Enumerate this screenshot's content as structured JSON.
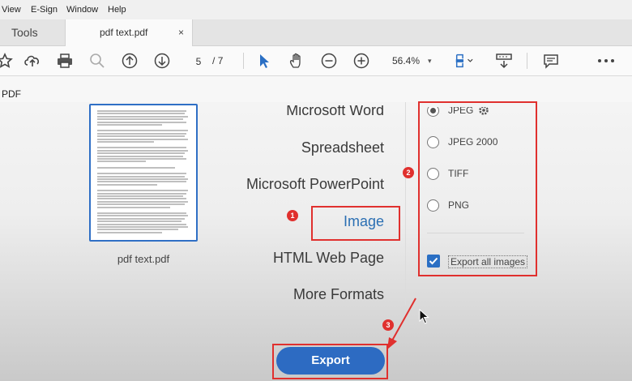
{
  "menu": {
    "items": [
      "View",
      "E-Sign",
      "Window",
      "Help"
    ]
  },
  "tabs": {
    "tools": "Tools",
    "document": "pdf text.pdf",
    "close": "×"
  },
  "toolbar": {
    "page_current": "5",
    "page_separator": "/",
    "page_total": "7",
    "zoom": "56.4%",
    "zoom_arrow": "▾",
    "icons": [
      "star-icon",
      "cloud-upload-icon",
      "print-icon",
      "zoom-search-icon",
      "page-up-icon",
      "page-down-icon",
      "pointer-icon",
      "hand-icon",
      "zoom-out-icon",
      "zoom-in-icon",
      "fit-page-icon",
      "scroll-mode-icon",
      "comment-icon",
      "more-icon"
    ]
  },
  "subbar": {
    "label": "PDF"
  },
  "thumbnail": {
    "label": "pdf text.pdf"
  },
  "formats": {
    "items": [
      "Microsoft Word",
      "Spreadsheet",
      "Microsoft PowerPoint",
      "Image",
      "HTML Web Page",
      "More Formats"
    ],
    "selected": "Image"
  },
  "image_options": {
    "items": [
      "JPEG",
      "JPEG 2000",
      "TIFF",
      "PNG"
    ],
    "selected": "JPEG",
    "export_all_label": "Export all images",
    "export_all_checked": true
  },
  "export_button": {
    "label": "Export"
  },
  "annotations": {
    "badge1": "1",
    "badge2": "2",
    "badge3": "3",
    "highlight_color": "#e0302e"
  },
  "colors": {
    "accent": "#2d6bc2",
    "selected_text": "#2b6fb3"
  }
}
